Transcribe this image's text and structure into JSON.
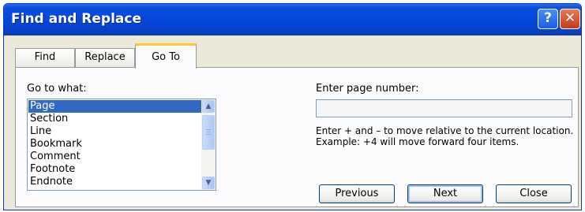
{
  "window": {
    "title": "Find and Replace",
    "help_label": "?",
    "close_label": "✕"
  },
  "tabs": [
    {
      "label": "Find",
      "active": false
    },
    {
      "label": "Replace",
      "active": false
    },
    {
      "label": "Go To",
      "active": true
    }
  ],
  "go_to_what": {
    "label": "Go to what:",
    "items": [
      "Page",
      "Section",
      "Line",
      "Bookmark",
      "Comment",
      "Footnote",
      "Endnote"
    ],
    "selected": "Page"
  },
  "page_number": {
    "label": "Enter page number:",
    "value": ""
  },
  "help_text": "Enter + and – to move relative to the current location. Example: +4 will move forward four items.",
  "buttons": {
    "previous": "Previous",
    "next": "Next",
    "close": "Close"
  },
  "scrollbar_icons": {
    "up": "▲",
    "down": "▼"
  },
  "colors": {
    "titlebar": "#0747d6",
    "selection": "#316ac5",
    "active_tab_accent": "#ffc83c",
    "dialog_bg": "#ece9d8"
  }
}
